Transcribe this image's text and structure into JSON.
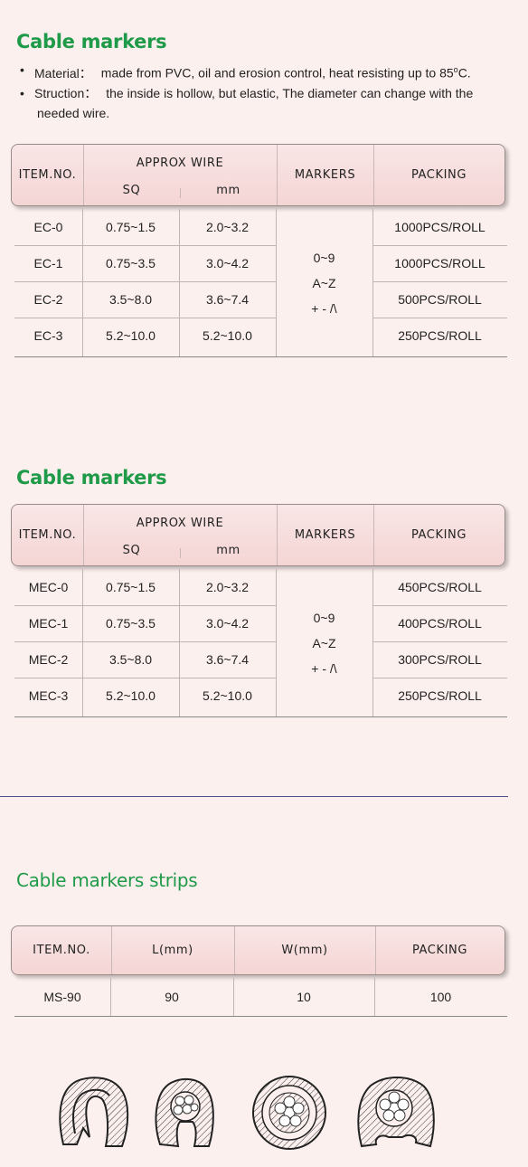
{
  "section1": {
    "title": "Cable markers",
    "bullets": [
      {
        "key": "Material：",
        "text": "made from PVC, oil and erosion control, heat resisting up to 85",
        "degree": "o",
        "suffix": "C."
      },
      {
        "key": "Struction：",
        "text": "the inside is hollow, but elastic, The diameter can change with the",
        "cont": "needed wire."
      }
    ],
    "headers": {
      "item": "ITEM.NO.",
      "approx": "APPROX WIRE",
      "sq": "SQ",
      "mm": "mm",
      "markers": "MARKERS",
      "packing": "PACKING"
    },
    "rows": [
      {
        "item": "EC-0",
        "sq": "0.75~1.5",
        "mm": "2.0~3.2",
        "packing": "1000PCS/ROLL"
      },
      {
        "item": "EC-1",
        "sq": "0.75~3.5",
        "mm": "3.0~4.2",
        "packing": "1000PCS/ROLL"
      },
      {
        "item": "EC-2",
        "sq": "3.5~8.0",
        "mm": "3.6~7.4",
        "packing": "500PCS/ROLL"
      },
      {
        "item": "EC-3",
        "sq": "5.2~10.0",
        "mm": "5.2~10.0",
        "packing": "250PCS/ROLL"
      }
    ],
    "markers": [
      "0~9",
      "A~Z",
      "+ - /\\"
    ]
  },
  "section2": {
    "title": "Cable markers",
    "headers": {
      "item": "ITEM.NO.",
      "approx": "APPROX WIRE",
      "sq": "SQ",
      "mm": "mm",
      "markers": "MARKERS",
      "packing": "PACKING"
    },
    "rows": [
      {
        "item": "MEC-0",
        "sq": "0.75~1.5",
        "mm": "2.0~3.2",
        "packing": "450PCS/ROLL"
      },
      {
        "item": "MEC-1",
        "sq": "0.75~3.5",
        "mm": "3.0~4.2",
        "packing": "400PCS/ROLL"
      },
      {
        "item": "MEC-2",
        "sq": "3.5~8.0",
        "mm": "3.6~7.4",
        "packing": "300PCS/ROLL"
      },
      {
        "item": "MEC-3",
        "sq": "5.2~10.0",
        "mm": "5.2~10.0",
        "packing": "250PCS/ROLL"
      }
    ],
    "markers": [
      "0~9",
      "A~Z",
      "+ - /\\"
    ]
  },
  "section3": {
    "title": "Cable markers strips",
    "headers": {
      "item": "ITEM.NO.",
      "l": "L(mm)",
      "w": "W(mm)",
      "packing": "PACKING"
    },
    "rows": [
      {
        "item": "MS-90",
        "l": "90",
        "w": "10",
        "packing": "100"
      }
    ]
  },
  "colors": {
    "title": "#1f9a48",
    "background": "#fcf0ee",
    "header": "#f4d5d4",
    "separator": "#4e4f8a"
  },
  "illustrations": [
    "cable-marker-empty-icon",
    "cable-marker-small-wire-icon",
    "cable-marker-round-wire-icon",
    "cable-marker-large-wire-icon"
  ]
}
